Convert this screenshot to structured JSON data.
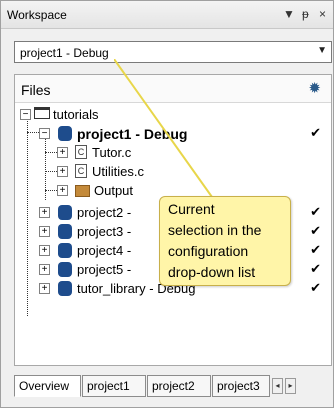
{
  "titlebar": {
    "title": "Workspace",
    "controls": [
      "▼",
      "ᵽ",
      "×"
    ]
  },
  "config": {
    "selected": "project1 - Debug"
  },
  "files": {
    "header": "Files",
    "tree": [
      {
        "label": "tutorials",
        "bold": false,
        "checked": false
      },
      {
        "label": "project1 - Debug",
        "bold": true,
        "checked": true
      },
      {
        "label": "Tutor.c"
      },
      {
        "label": "Utilities.c"
      },
      {
        "label": "Output"
      },
      {
        "label": "project2 -",
        "checked": true
      },
      {
        "label": "project3 -",
        "checked": true
      },
      {
        "label": "project4 -",
        "checked": true
      },
      {
        "label": "project5 -",
        "checked": true
      },
      {
        "label": "tutor_library - Debug",
        "checked": true
      }
    ]
  },
  "callout": {
    "lines": [
      "Current",
      "selection in the",
      "configuration",
      "drop-down list"
    ],
    "color": "#fff5a8"
  },
  "tabs": [
    "Overview",
    "project1",
    "project2",
    "project3"
  ],
  "icons": {
    "settings": "gear-icon",
    "check": "✔"
  },
  "colors": {
    "project_icon": "#1e4c8c",
    "callout_bg": "#fff5a8"
  }
}
